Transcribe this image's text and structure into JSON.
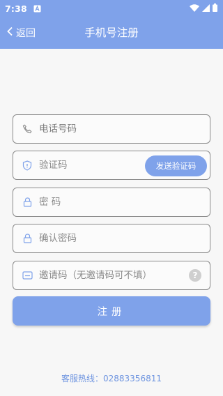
{
  "status_bar": {
    "time": "7:38"
  },
  "header": {
    "back_label": "返回",
    "title": "手机号注册"
  },
  "form": {
    "phone": {
      "placeholder": "电话号码",
      "value": ""
    },
    "code": {
      "placeholder": "验证码",
      "value": "",
      "send_button_label": "发送验证码"
    },
    "password": {
      "placeholder": "密 码",
      "value": ""
    },
    "confirm_password": {
      "placeholder": "确认密码",
      "value": ""
    },
    "invite_code": {
      "placeholder": "邀请码（无邀请码可不填）",
      "value": "",
      "help_label": "?"
    },
    "register_button_label": "注册"
  },
  "footer": {
    "hotline": "客服热线：02883356811"
  },
  "colors": {
    "accent": "#7fa2ea",
    "hotline_text": "#6f95e0",
    "field_border": "#8a8a8a"
  },
  "icons": {
    "phone": "phone-icon",
    "code": "shield-icon",
    "password": "lock-icon",
    "confirm_password": "lock-icon",
    "invite_code": "card-icon",
    "help": "question-icon",
    "back": "chevron-left-icon"
  }
}
